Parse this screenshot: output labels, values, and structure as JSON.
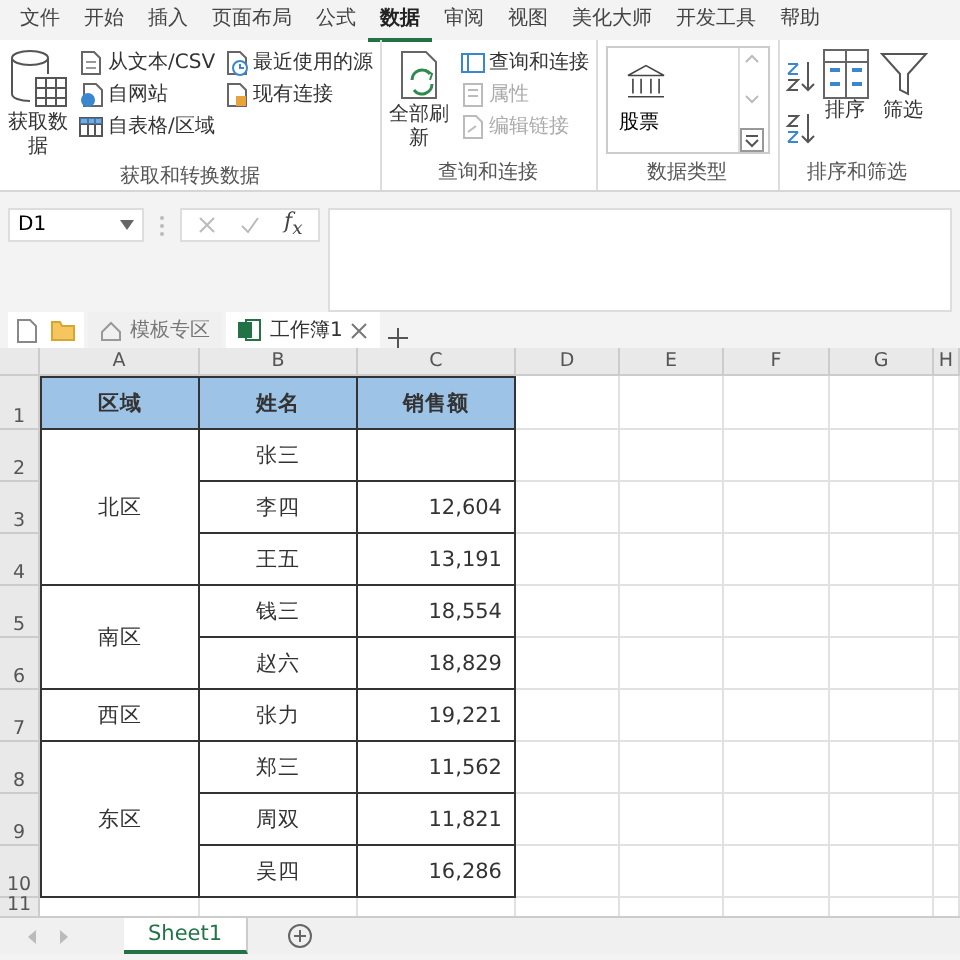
{
  "ribbon": {
    "tabs": [
      {
        "label": "文件",
        "selected": false
      },
      {
        "label": "开始",
        "selected": false
      },
      {
        "label": "插入",
        "selected": false
      },
      {
        "label": "页面布局",
        "selected": false
      },
      {
        "label": "公式",
        "selected": false
      },
      {
        "label": "数据",
        "selected": true
      },
      {
        "label": "审阅",
        "selected": false
      },
      {
        "label": "视图",
        "selected": false
      },
      {
        "label": "美化大师",
        "selected": false
      },
      {
        "label": "开发工具",
        "selected": false
      },
      {
        "label": "帮助",
        "selected": false
      }
    ],
    "groups": [
      {
        "label": "获取和转换数据",
        "items": [
          {
            "kind": "large",
            "label": "获取数据"
          },
          {
            "kind": "small",
            "label": "从文本/CSV",
            "disabled": false
          },
          {
            "kind": "small",
            "label": "自网站",
            "disabled": false
          },
          {
            "kind": "small",
            "label": "自表格/区域",
            "disabled": false
          },
          {
            "kind": "small",
            "label": "最近使用的源",
            "disabled": false
          },
          {
            "kind": "small",
            "label": "现有连接",
            "disabled": false
          }
        ]
      },
      {
        "label": "查询和连接",
        "items": [
          {
            "kind": "large",
            "label": "全部刷新"
          },
          {
            "kind": "small",
            "label": "查询和连接",
            "disabled": false
          },
          {
            "kind": "small",
            "label": "属性",
            "disabled": true
          },
          {
            "kind": "small",
            "label": "编辑链接",
            "disabled": true
          }
        ]
      },
      {
        "label": "数据类型",
        "items": [
          {
            "kind": "gallery",
            "label": "股票"
          }
        ]
      },
      {
        "label": "排序和筛选",
        "items": [
          {
            "kind": "sort"
          },
          {
            "kind": "large",
            "label": "排序"
          },
          {
            "kind": "large",
            "label": "筛选"
          }
        ]
      }
    ]
  },
  "formula_bar": {
    "name_box": "D1",
    "function_button": "f$_{x}$"
  },
  "doc_tabs": [
    {
      "label": "模板专区",
      "selected": false
    },
    {
      "label": "工作簿1",
      "selected": true
    }
  ],
  "sheet": {
    "columns": [
      "A",
      "B",
      "C",
      "D",
      "E",
      "F",
      "G",
      "H"
    ],
    "rows": [
      "1",
      "2",
      "3",
      "4",
      "5",
      "6",
      "7",
      "8",
      "9",
      "10",
      "11"
    ],
    "header": [
      "区域",
      "姓名",
      "销售额"
    ],
    "regions": [
      {
        "region": "北区",
        "rows": [
          {
            "name": "张三"
          },
          {
            "name": "李四",
            "sales": "12,604"
          },
          {
            "name": "王五",
            "sales": "13,191"
          }
        ]
      },
      {
        "region": "南区",
        "rows": [
          {
            "name": "钱三",
            "sales": "18,554"
          },
          {
            "name": "赵六",
            "sales": "18,829"
          }
        ]
      },
      {
        "region": "西区",
        "rows": [
          {
            "name": "张力",
            "sales": "19,221"
          }
        ]
      },
      {
        "region": "东区",
        "rows": [
          {
            "name": "郑三",
            "sales": "11,562"
          },
          {
            "name": "周双",
            "sales": "11,821"
          },
          {
            "name": "吴四",
            "sales": "16,286"
          }
        ]
      }
    ]
  },
  "sheet_tabs": [
    {
      "label": "Sheet1",
      "selected": true
    }
  ]
}
